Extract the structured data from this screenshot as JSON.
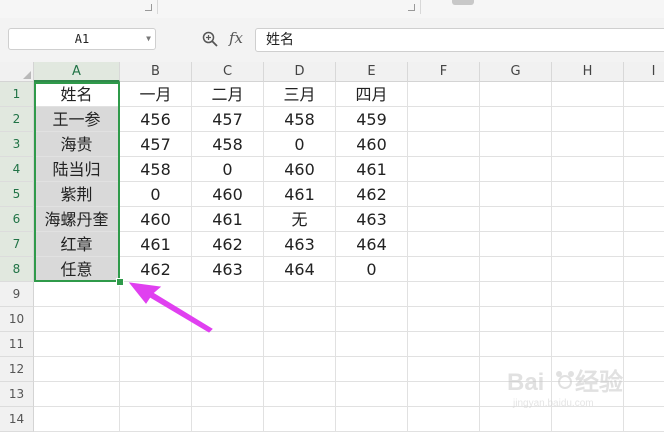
{
  "formula_bar": {
    "cell_ref": "A1",
    "fx_label": "fx",
    "formula_value": "姓名"
  },
  "columns": [
    "A",
    "B",
    "C",
    "D",
    "E",
    "F",
    "G",
    "H",
    "I"
  ],
  "rows": [
    "1",
    "2",
    "3",
    "4",
    "5",
    "6",
    "7",
    "8",
    "9",
    "10",
    "11",
    "12",
    "13",
    "14"
  ],
  "table": [
    [
      "姓名",
      "一月",
      "二月",
      "三月",
      "四月"
    ],
    [
      "王一参",
      "456",
      "457",
      "458",
      "459"
    ],
    [
      "海贵",
      "457",
      "458",
      "0",
      "460"
    ],
    [
      "陆当归",
      "458",
      "0",
      "460",
      "461"
    ],
    [
      "紫荆",
      "0",
      "460",
      "461",
      "462"
    ],
    [
      "海螺丹奎",
      "460",
      "461",
      "无",
      "463"
    ],
    [
      "红章",
      "461",
      "462",
      "463",
      "464"
    ],
    [
      "任意",
      "462",
      "463",
      "464",
      "0"
    ]
  ],
  "selection": {
    "column": "A",
    "first_row": 1,
    "last_row": 8
  },
  "colors": {
    "selection": "#2f9a4a",
    "arrow": "#e040f0",
    "selected_fill": "#d9d9d9"
  },
  "icons": {
    "zoom": "zoom-search-icon",
    "fill_handle": "fill-handle-icon",
    "annotation": "magenta-arrow-icon"
  }
}
